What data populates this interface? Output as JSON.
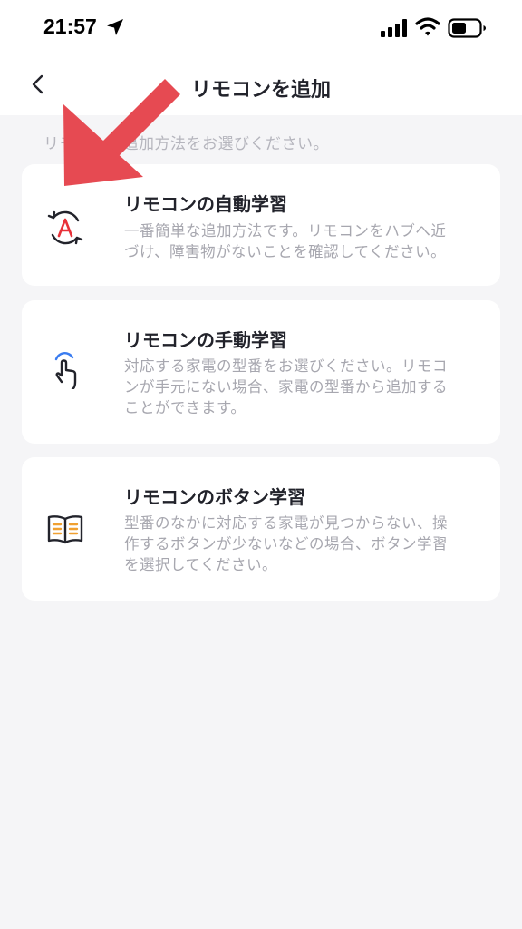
{
  "status_bar": {
    "time": "21:57",
    "icons": [
      "location-arrow-icon",
      "signal-icon",
      "wifi-icon",
      "battery-icon"
    ]
  },
  "nav": {
    "title": "リモコンを追加",
    "back_icon": "chevron-left-icon"
  },
  "hint": "リモコンの追加方法をお選びください。",
  "options": [
    {
      "icon": "auto-learn-icon",
      "title": "リモコンの自動学習",
      "description": [
        "一番簡単な追加方法です。リモコンをハブへ近",
        "づけ、障害物がないことを確認してください。"
      ]
    },
    {
      "icon": "hand-tap-icon",
      "title": "リモコンの手動学習",
      "description": [
        "対応する家電の型番をお選びください。リモコ",
        "ンが手元にない場合、家電の型番から追加する",
        "ことができます。"
      ]
    },
    {
      "icon": "open-book-icon",
      "title": "リモコンのボタン学習",
      "description": [
        "型番のなかに対応する家電が見つからない、操",
        "作するボタンが少ないなどの場合、ボタン学習",
        "を選択してください。"
      ]
    }
  ],
  "colors": {
    "background": "#f5f5f7",
    "card": "#ffffff",
    "text": "#22232b",
    "muted_text": "#a7a7af",
    "accent_red": "#e8323a",
    "accent_blue": "#3a7cf0",
    "accent_orange": "#f0a030",
    "annotation_arrow": "#e64a52"
  }
}
